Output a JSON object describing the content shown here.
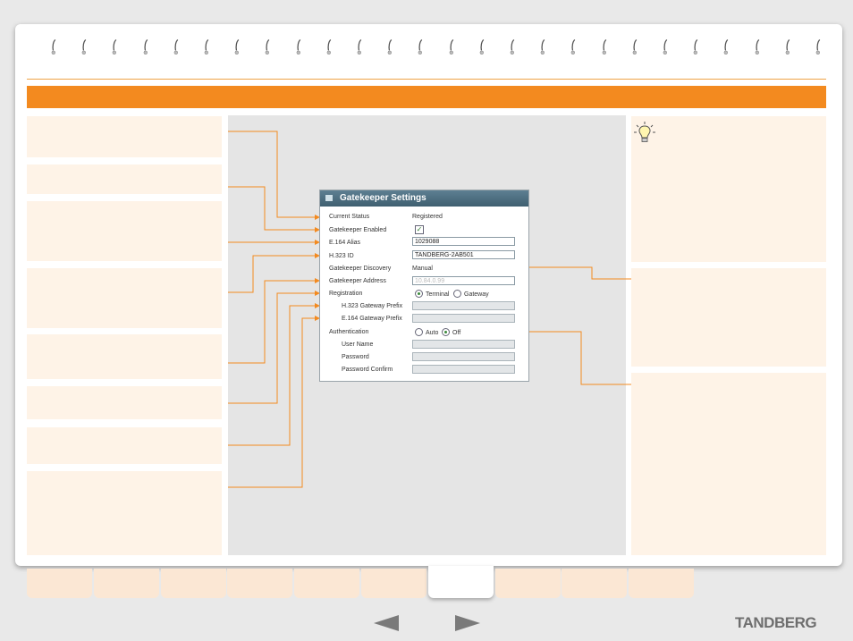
{
  "dialog": {
    "title": "Gatekeeper Settings",
    "rows": {
      "current_status": {
        "label": "Current Status",
        "value": "Registered"
      },
      "gatekeeper_enabled": {
        "label": "Gatekeeper Enabled",
        "checked": true
      },
      "e164_alias": {
        "label": "E.164 Alias",
        "value": "1029088"
      },
      "h323_id": {
        "label": "H.323 ID",
        "value": "TANDBERG-2AB501"
      },
      "gatekeeper_discovery": {
        "label": "Gatekeeper Discovery",
        "value": "Manual"
      },
      "gatekeeper_address": {
        "label": "Gatekeeper Address",
        "value": "10.84.0.99"
      },
      "registration": {
        "label": "Registration",
        "option_terminal": "Terminal",
        "option_gateway": "Gateway",
        "selected": "Terminal"
      },
      "h323_gateway_prefix": {
        "label": "H.323 Gateway Prefix",
        "value": ""
      },
      "e164_gateway_prefix": {
        "label": "E.164 Gateway Prefix",
        "value": ""
      },
      "authentication": {
        "label": "Authentication",
        "option_auto": "Auto",
        "option_off": "Off",
        "selected": "Off"
      },
      "user_name": {
        "label": "User Name",
        "value": ""
      },
      "password": {
        "label": "Password",
        "value": ""
      },
      "password_confirm": {
        "label": "Password Confirm",
        "value": ""
      }
    }
  },
  "tips": {
    "icon": "lightbulb-icon"
  },
  "footer": {
    "logo": "TANDBERG",
    "prev_icon": "left-arrow-icon",
    "next_icon": "right-arrow-icon"
  },
  "tabs_count": 10,
  "active_tab_index": 6,
  "colors": {
    "accent": "#f38a1f",
    "panel": "#fef3e7",
    "dialog_title": "#4a6b7d"
  }
}
